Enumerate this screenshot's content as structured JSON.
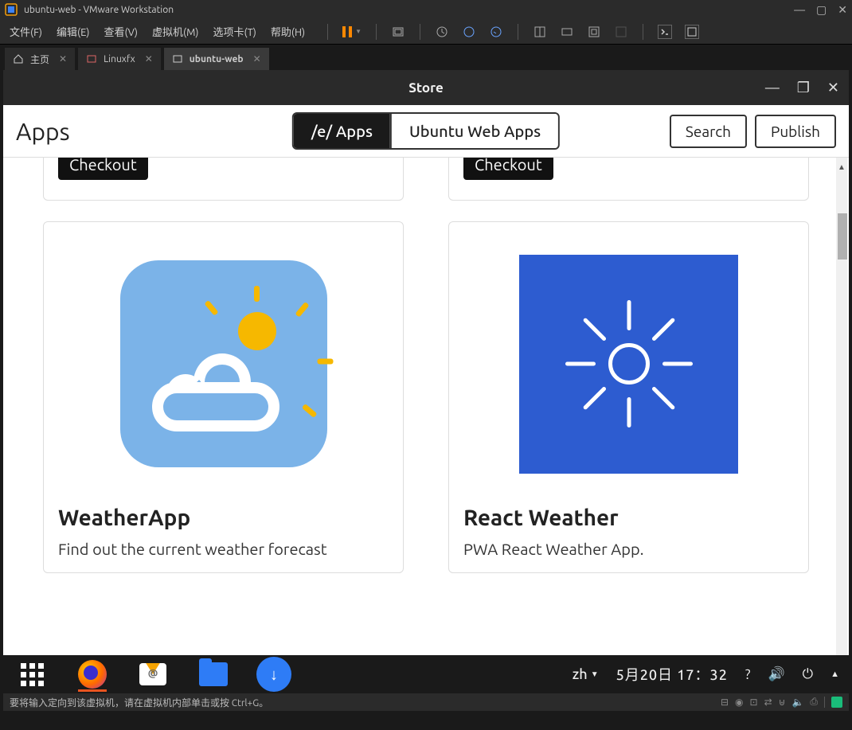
{
  "vmware": {
    "title": "ubuntu-web - VMware Workstation",
    "menu": {
      "file": "文件(F)",
      "edit": "编辑(E)",
      "view": "查看(V)",
      "vm": "虚拟机(M)",
      "tabs": "选项卡(T)",
      "help": "帮助(H)"
    },
    "tabs": {
      "home": "主页",
      "linuxfx": "Linuxfx",
      "ubuntu": "ubuntu-web"
    },
    "status": "要将输入定向到该虚拟机，请在虚拟机内部单击或按 Ctrl+G。"
  },
  "store": {
    "window_title": "Store",
    "heading": "Apps",
    "toggle": {
      "e_apps": "/e/ Apps",
      "ubuntu_web": "Ubuntu Web Apps"
    },
    "search": "Search",
    "publish": "Publish",
    "checkout": "Checkout",
    "cards": [
      {
        "title": "WeatherApp",
        "desc": "Find out the current weather forecast"
      },
      {
        "title": "React Weather",
        "desc": "PWA React Weather App."
      }
    ]
  },
  "taskbar": {
    "ime": "zh",
    "datetime": "5月20日  17：32"
  }
}
